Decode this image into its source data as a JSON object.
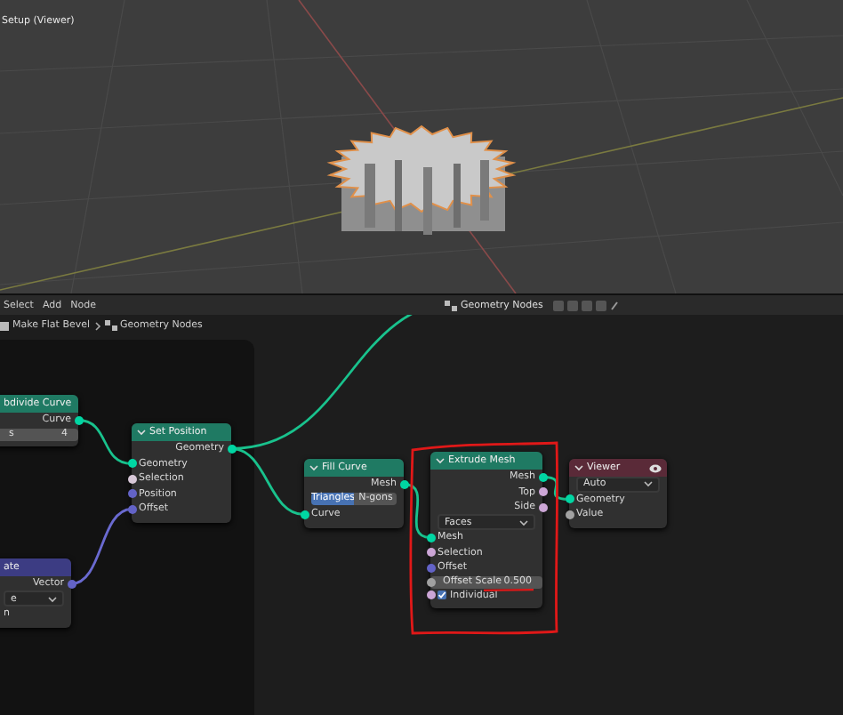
{
  "viewport": {
    "title": "Setup (Viewer)"
  },
  "node_editor": {
    "menu": [
      "Select",
      "Add",
      "Node"
    ],
    "tree_name": "Geometry Nodes",
    "breadcrumbs": [
      "Make Flat Bevel",
      "Geometry Nodes"
    ]
  },
  "nodes": [
    {
      "title": "bdivide Curve",
      "color": "#1f7a63",
      "rows": [
        {
          "kind": "output",
          "label": "Curve",
          "color": "#00d6a3"
        },
        {
          "kind": "field",
          "label": "s",
          "value": "4"
        }
      ]
    },
    {
      "title": "Set Position",
      "color": "#1f7a63",
      "rows": [
        {
          "kind": "output",
          "label": "Geometry",
          "color": "#00d6a3"
        },
        {
          "kind": "input",
          "label": "Geometry",
          "color": "#00d6a3"
        },
        {
          "kind": "input",
          "label": "Selection",
          "color": "#d8c8d8"
        },
        {
          "kind": "input",
          "label": "Position",
          "color": "#6363c7"
        },
        {
          "kind": "input",
          "label": "Offset",
          "color": "#6363c7"
        }
      ]
    },
    {
      "title": "ate",
      "color": "#3c3c83",
      "rows": [
        {
          "kind": "output",
          "label": "Vector",
          "color": "#6363c7"
        },
        {
          "kind": "dropdown",
          "label": "e"
        },
        {
          "kind": "text",
          "label": "n"
        }
      ]
    },
    {
      "title": "Fill Curve",
      "color": "#1f7a63",
      "rows": [
        {
          "kind": "output",
          "label": "Mesh",
          "color": "#00d6a3"
        },
        {
          "kind": "toggle",
          "options": [
            {
              "label": "Triangles",
              "selected": true
            },
            {
              "label": "N-gons",
              "selected": false
            }
          ]
        },
        {
          "kind": "input",
          "label": "Curve",
          "color": "#00d6a3"
        }
      ]
    },
    {
      "title": "Extrude Mesh",
      "color": "#1f7a63",
      "rows": [
        {
          "kind": "output",
          "label": "Mesh",
          "color": "#00d6a3"
        },
        {
          "kind": "output",
          "label": "Top",
          "color": "#cca6d6"
        },
        {
          "kind": "output",
          "label": "Side",
          "color": "#cca6d6"
        },
        {
          "kind": "dropdown",
          "label": "Faces"
        },
        {
          "kind": "input",
          "label": "Mesh",
          "color": "#00d6a3"
        },
        {
          "kind": "input",
          "label": "Selection",
          "color": "#cca6d6"
        },
        {
          "kind": "input",
          "label": "Offset",
          "color": "#6363c7"
        },
        {
          "kind": "field",
          "label": "Offset Scale",
          "value": "0.500",
          "color": "#a1a1a1"
        },
        {
          "kind": "checkbox",
          "label": "Individual",
          "checked": true,
          "color": "#cca6d6"
        }
      ]
    },
    {
      "title": "Viewer",
      "color": "#5a2a38",
      "rows": [
        {
          "kind": "dropdown",
          "label": "Auto"
        },
        {
          "kind": "input",
          "label": "Geometry",
          "color": "#00d6a3"
        },
        {
          "kind": "input",
          "label": "Value",
          "color": "#a1a1a1"
        }
      ]
    }
  ]
}
